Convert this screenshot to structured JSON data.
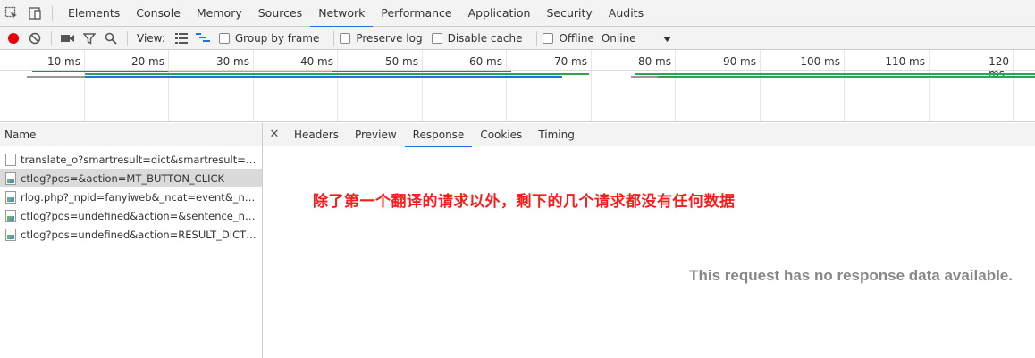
{
  "devtools": {
    "tabs": [
      "Elements",
      "Console",
      "Memory",
      "Sources",
      "Network",
      "Performance",
      "Application",
      "Security",
      "Audits"
    ],
    "active_tab": "Network"
  },
  "toolbar": {
    "view_label": "View:",
    "group_by_frame": "Group by frame",
    "preserve_log": "Preserve log",
    "disable_cache": "Disable cache",
    "offline": "Offline",
    "throttling": "Online",
    "record_color": "#e8000b"
  },
  "overview": {
    "ticks": [
      "10 ms",
      "20 ms",
      "30 ms",
      "40 ms",
      "50 ms",
      "60 ms",
      "70 ms",
      "80 ms",
      "90 ms",
      "100 ms",
      "110 ms",
      "120 ms"
    ]
  },
  "requests": {
    "header": "Name",
    "items": [
      {
        "name": "translate_o?smartresult=dict&smartresult=rule",
        "icon": "document-icon",
        "selected": false
      },
      {
        "name": "ctlog?pos=&action=MT_BUTTON_CLICK",
        "icon": "image-icon",
        "selected": true
      },
      {
        "name": "rlog.php?_npid=fanyiweb&_ncat=event&_ncoo...",
        "icon": "image-icon",
        "selected": false
      },
      {
        "name": "ctlog?pos=undefined&action=&sentence_numb...",
        "icon": "image-icon",
        "selected": false
      },
      {
        "name": "ctlog?pos=undefined&action=RESULT_DICT_SH...",
        "icon": "image-icon",
        "selected": false
      }
    ]
  },
  "detail": {
    "tabs": [
      "Headers",
      "Preview",
      "Response",
      "Cookies",
      "Timing"
    ],
    "active_tab": "Response",
    "empty_message": "This request has no response data available.",
    "annotation": "除了第一个翻译的请求以外，剩下的几个请求都没有任何数据"
  }
}
